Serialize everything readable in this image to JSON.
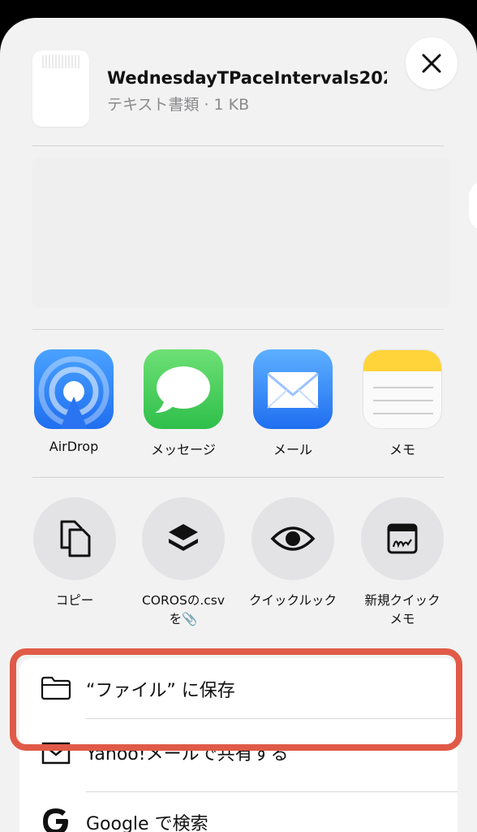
{
  "header": {
    "file_name": "WednesdayTPaceIntervals202...",
    "file_meta": "テキスト書類 · 1 KB"
  },
  "apps": [
    {
      "label": "AirDrop",
      "icon": "airdrop-icon",
      "color": "#2f7cf6"
    },
    {
      "label": "メッセージ",
      "icon": "messages-icon",
      "color": "#34c759"
    },
    {
      "label": "メール",
      "icon": "mail-icon",
      "color": "#2f7cf6"
    },
    {
      "label": "メモ",
      "icon": "notes-icon",
      "color": "#ffd43b"
    }
  ],
  "actions": [
    {
      "label": "コピー",
      "icon": "copy-icon"
    },
    {
      "label_line1": "COROSの.csv",
      "label_line2": "を📎",
      "icon": "layers-icon"
    },
    {
      "label": "クイックルック",
      "icon": "eye-icon"
    },
    {
      "label_line1": "新規クイック",
      "label_line2": "メモ",
      "icon": "quick-note-icon"
    }
  ],
  "list": [
    {
      "label": "“ファイル” に保存",
      "icon": "folder-icon"
    },
    {
      "label": "Yahoo!メールで共有する",
      "icon": "envelope-icon"
    },
    {
      "label": "Google で検索",
      "icon": "google-g-icon"
    }
  ],
  "colors": {
    "highlight": "#e05a47",
    "sheet_bg": "#f2f2f2"
  }
}
